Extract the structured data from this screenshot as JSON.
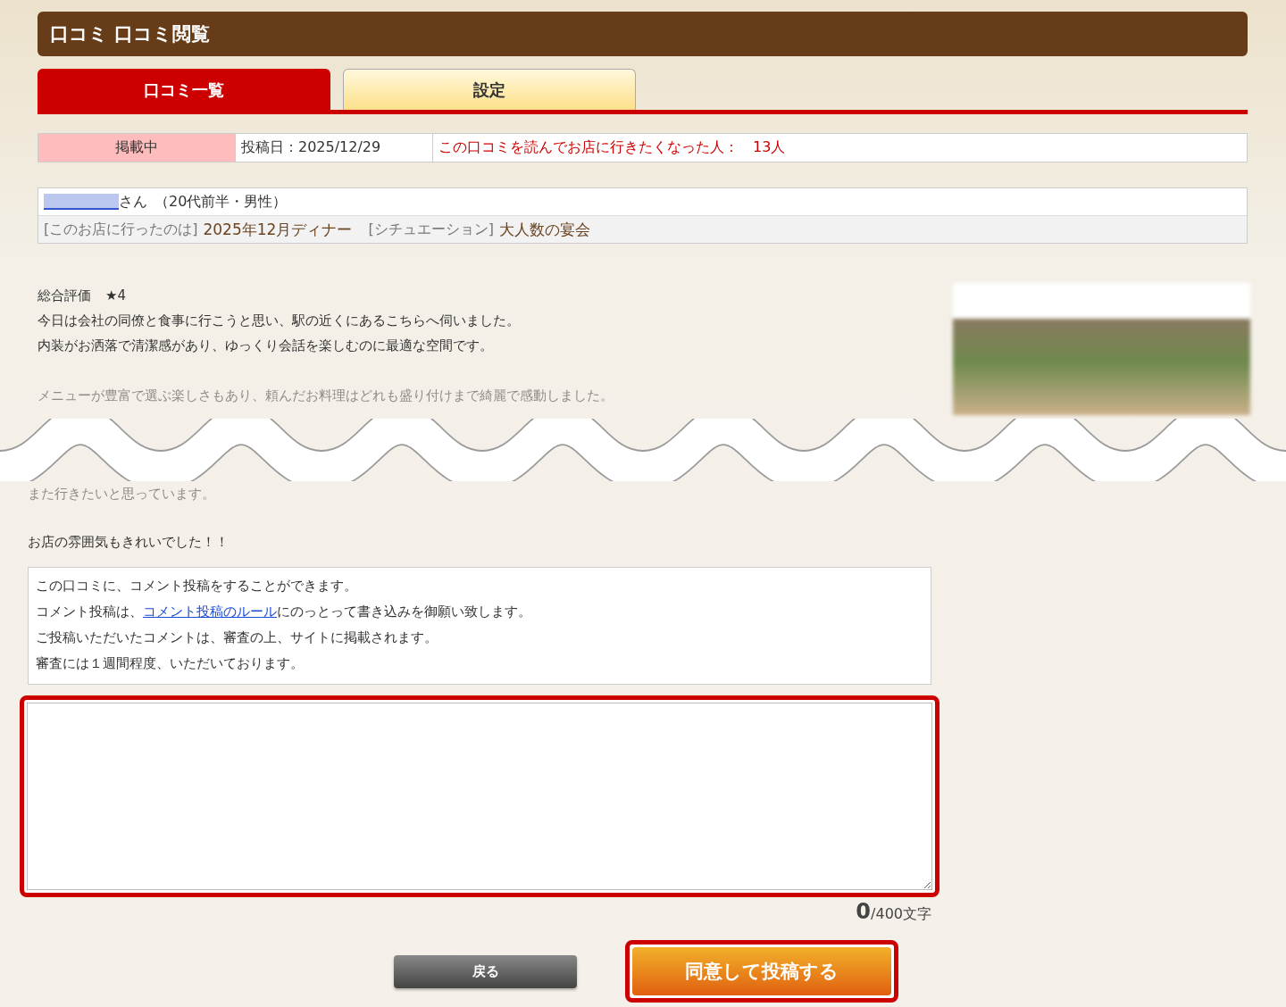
{
  "header": {
    "title": "口コミ 口コミ閲覧"
  },
  "tabs": [
    {
      "label": "口コミ一覧",
      "selected": true
    },
    {
      "label": "設定",
      "selected": false
    }
  ],
  "info_row": {
    "status": "掲載中",
    "posted": "投稿日：2025/12/29",
    "helpful_label": "この口コミを読んでお店に行きたくなった人：",
    "helpful_count": "13人"
  },
  "reviewer": {
    "suffix": "さん",
    "profile": "（20代前半・男性）",
    "visit_label": "[このお店に行ったのは]",
    "visit_value": "2025年12月ディナー",
    "situation_label": "[シチュエーション]",
    "situation_value": "大人数の宴会"
  },
  "review": {
    "rating_label": "総合評価",
    "rating": "★4",
    "lines": [
      "今日は会社の同僚と食事に行こうと思い、駅の近くにあるこちらへ伺いました。",
      "内装がお洒落で清潔感があり、ゆっくり会話を楽しむのに最適な空間です。"
    ],
    "faded_before": "メニューが豊富で選ぶ楽しさもあり、頼んだお料理はどれも盛り付けまで綺麗で感動しました。",
    "faded_after": "また行きたいと思っています。",
    "closing": "お店の雰囲気もきれいでした！！"
  },
  "notice": {
    "line_1": "この口コミに、コメント投稿をすることができます。",
    "line_2_before": "コメント投稿は、",
    "line_2_link": "コメント投稿のルール",
    "line_2_after": "にのっとって書き込みを御願い致します。",
    "line_3": "ご投稿いただいたコメントは、審査の上、サイトに掲載されます。",
    "line_4": "審査には１週間程度、いただいております。"
  },
  "comment": {
    "count": "0",
    "limit": "/400文字"
  },
  "buttons": {
    "back": "戻る",
    "submit": "同意して投稿する"
  }
}
